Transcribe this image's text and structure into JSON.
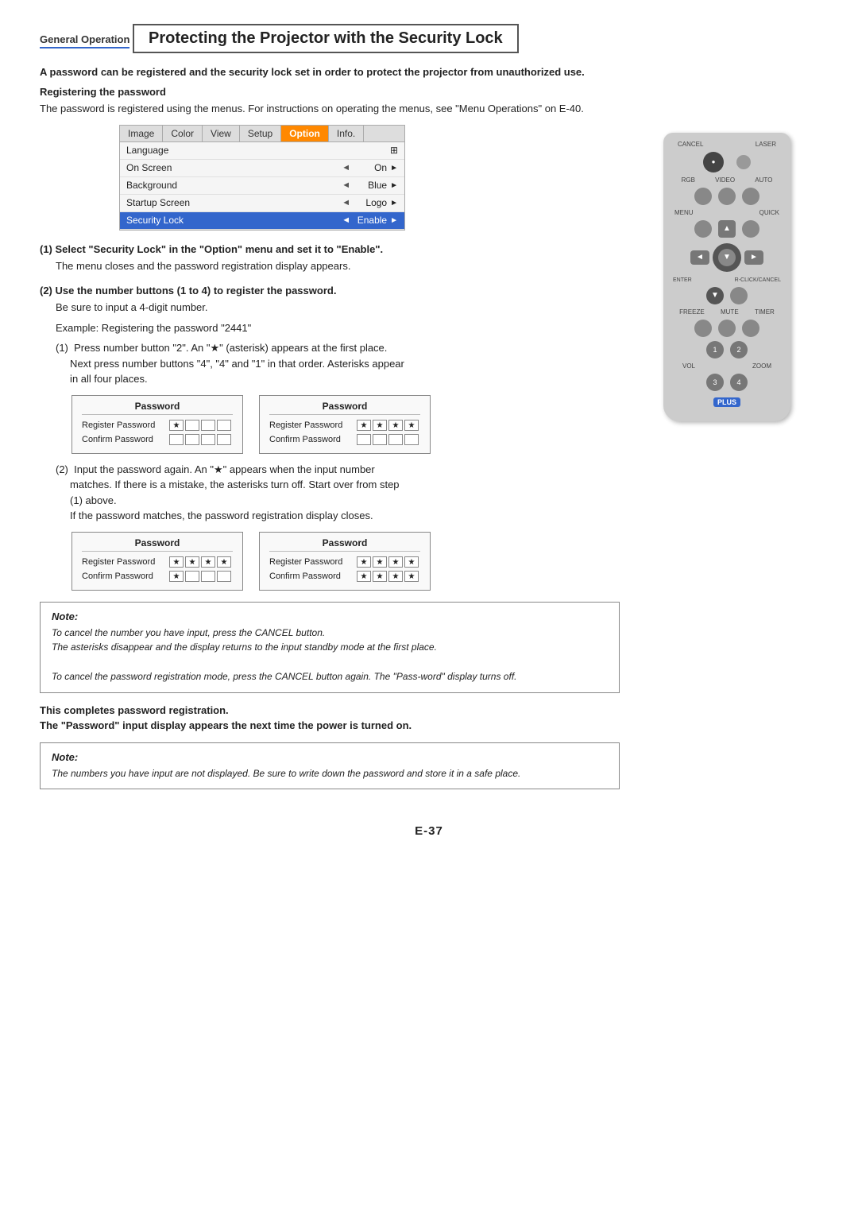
{
  "section": {
    "label": "General Operation"
  },
  "page_title": "Protecting the Projector with the Security Lock",
  "subtitle": "A password can be registered and the security lock set in order to protect the projector from unauthorized use.",
  "registering_heading": "Registering the password",
  "registering_body": "The password is registered using the menus. For instructions on operating the menus, see \"Menu Operations\" on E-40.",
  "menu": {
    "tabs": [
      "Image",
      "Color",
      "View",
      "Setup",
      "Option",
      "Info."
    ],
    "active_tab": "Option",
    "rows": [
      {
        "label": "Language",
        "arrow": "",
        "value": "",
        "icon": "⊡",
        "highlighted": false
      },
      {
        "label": "On Screen",
        "arrow": "◄",
        "value": "On",
        "icon": "►",
        "highlighted": false
      },
      {
        "label": "Background",
        "arrow": "◄",
        "value": "Blue",
        "icon": "►",
        "highlighted": false
      },
      {
        "label": "Startup Screen",
        "arrow": "◄",
        "value": "Logo",
        "icon": "►",
        "highlighted": false
      },
      {
        "label": "Security Lock",
        "arrow": "◄",
        "value": "Enable",
        "icon": "►",
        "highlighted": true
      }
    ]
  },
  "step1": {
    "header": "(1)  Select \"Security Lock\" in the \"Option\" menu and set it to \"Enable\".",
    "body": "The menu closes and the password registration display appears."
  },
  "step2": {
    "header": "(2)  Use the number buttons (1 to 4) to register the password.",
    "lines": [
      "Be sure to input a 4-digit number.",
      "Example: Registering the password \"2441\""
    ],
    "sub1": "(1)  Press number button \"2\". An \"★\" (asterisk) appears at the first place.\n     Next press number buttons \"4\", \"4\" and \"1\" in that order. Asterisks appear\n     in all four places.",
    "sub2": "(2)  Input the password again. An \"★\" appears when the input number\n     matches. If there is a mistake, the asterisks turn off. Start over from step\n     (1) above.\n     If the password matches, the password registration display closes."
  },
  "password_panels": {
    "row1": [
      {
        "title": "Password",
        "rows": [
          {
            "label": "Register Password",
            "boxes": [
              "★",
              "",
              "",
              ""
            ]
          },
          {
            "label": "Confirm Password",
            "boxes": [
              "",
              "",
              "",
              ""
            ]
          }
        ]
      },
      {
        "title": "Password",
        "rows": [
          {
            "label": "Register Password",
            "boxes": [
              "★",
              "★",
              "★",
              "★"
            ]
          },
          {
            "label": "Confirm Password",
            "boxes": [
              "",
              "",
              "",
              ""
            ]
          }
        ]
      }
    ],
    "row2": [
      {
        "title": "Password",
        "rows": [
          {
            "label": "Register Password",
            "boxes": [
              "★",
              "★",
              "★",
              "★"
            ]
          },
          {
            "label": "Confirm Password",
            "boxes": [
              "★",
              "",
              "",
              ""
            ]
          }
        ]
      },
      {
        "title": "Password",
        "rows": [
          {
            "label": "Register Password",
            "boxes": [
              "★",
              "★",
              "★",
              "★"
            ]
          },
          {
            "label": "Confirm Password",
            "boxes": [
              "★",
              "★",
              "★",
              "★"
            ]
          }
        ]
      }
    ]
  },
  "note1": {
    "label": "Note:",
    "lines": [
      "To cancel the number you have input, press the CANCEL button.",
      "The asterisks disappear and the display returns to the input standby mode at the first place.",
      "To cancel the password registration mode, press the CANCEL button again. The \"Pass-word\" display turns off."
    ]
  },
  "completion": {
    "line1": "This completes password registration.",
    "line2": "The \"Password\" input display appears the next time the power is turned on."
  },
  "note2": {
    "label": "Note:",
    "lines": [
      "The numbers you have input are not displayed. Be sure to write down the password and store it in a safe place."
    ]
  },
  "page_number": "E-37",
  "remote": {
    "rows": [
      [
        "CANCEL",
        "LASER"
      ],
      [
        "RGB",
        "VIDEO",
        "AUTO"
      ],
      [
        "MENU",
        "",
        "QUICK"
      ],
      [
        "nav"
      ],
      [
        "ENTER",
        "",
        "R-CLICK/CANCEL"
      ],
      [
        "FREEZE",
        "MUTE",
        "TIMER"
      ],
      [
        "1",
        "2"
      ],
      [
        "3",
        "4"
      ],
      [
        "VOL",
        "ZOOM"
      ],
      [
        "PLUS"
      ]
    ]
  }
}
